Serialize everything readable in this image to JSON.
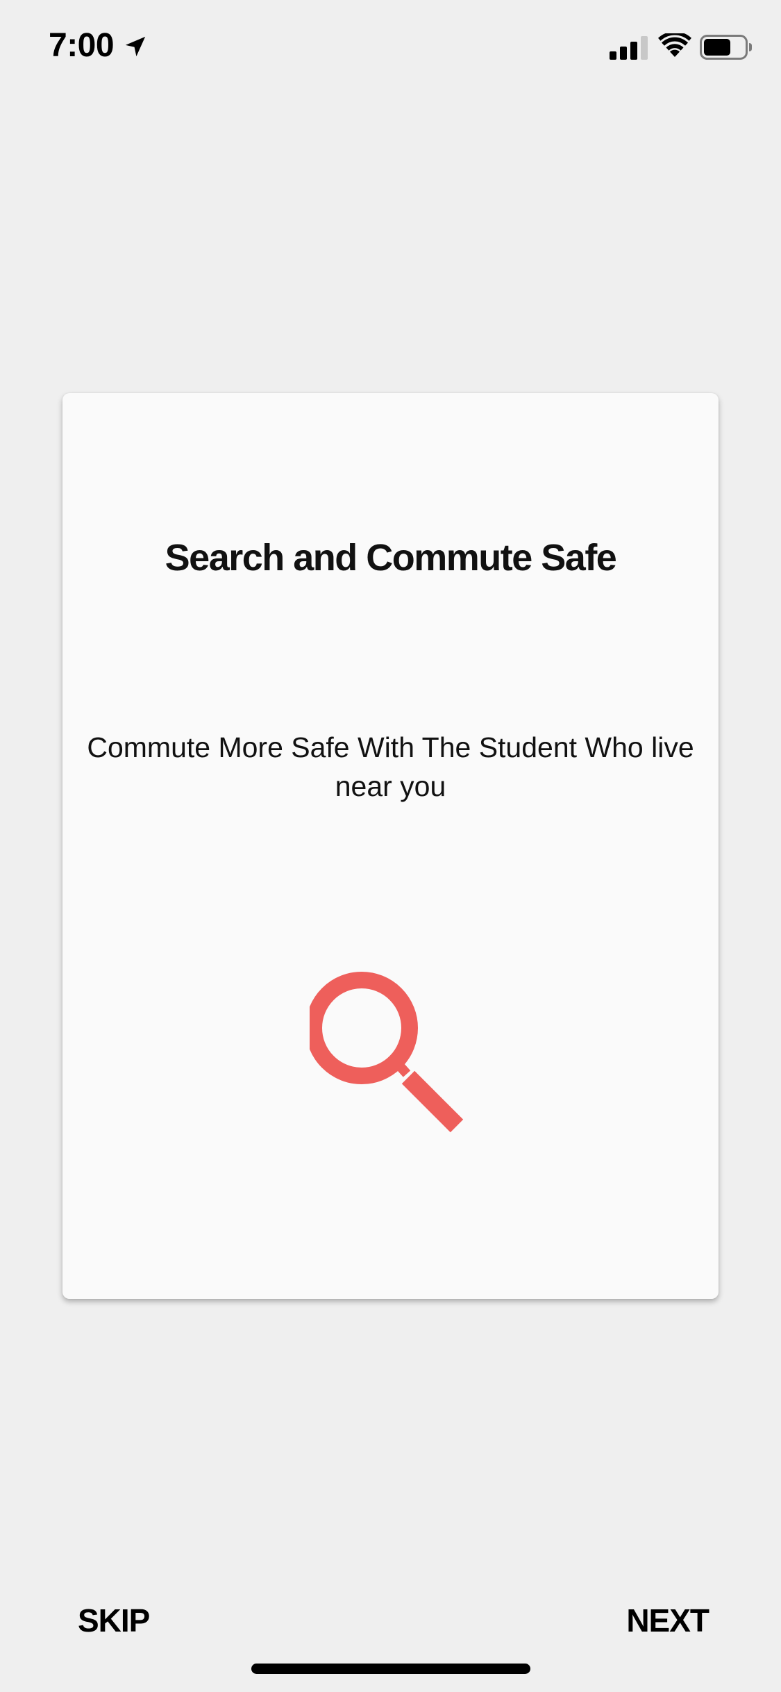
{
  "status_bar": {
    "time": "7:00",
    "icons": [
      "location-arrow-icon",
      "signal-icon",
      "wifi-icon",
      "battery-icon"
    ]
  },
  "onboarding": {
    "title": "Search and Commute Safe",
    "subtitle": "Commute More Safe With The Student Who live near you",
    "illustration": "search-icon",
    "accent_color": "#ee5f5b"
  },
  "navigation": {
    "skip_label": "SKIP",
    "next_label": "NEXT"
  }
}
